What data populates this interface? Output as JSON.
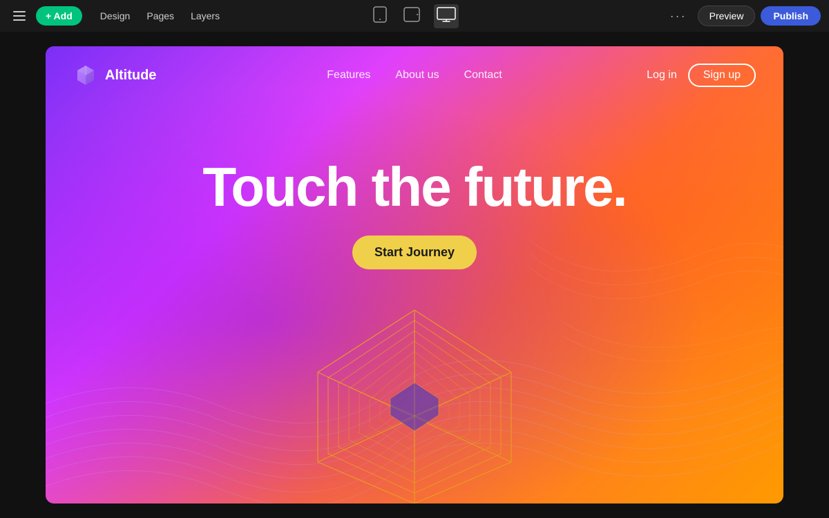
{
  "topbar": {
    "hamburger_label": "☰",
    "add_label": "+ Add",
    "nav_items": [
      {
        "id": "design",
        "label": "Design"
      },
      {
        "id": "pages",
        "label": "Pages"
      },
      {
        "id": "layers",
        "label": "Layers"
      }
    ],
    "device_icons": [
      {
        "id": "mobile",
        "symbol": "📱",
        "active": false
      },
      {
        "id": "tablet",
        "symbol": "▭",
        "active": false
      },
      {
        "id": "desktop",
        "symbol": "▬",
        "active": true
      }
    ],
    "more_label": "···",
    "preview_label": "Preview",
    "publish_label": "Publish"
  },
  "site": {
    "logo_text": "Altitude",
    "nav_links": [
      {
        "label": "Features"
      },
      {
        "label": "About us"
      },
      {
        "label": "Contact"
      }
    ],
    "login_label": "Log in",
    "signup_label": "Sign up",
    "hero_title": "Touch the future.",
    "cta_label": "Start Journey"
  }
}
